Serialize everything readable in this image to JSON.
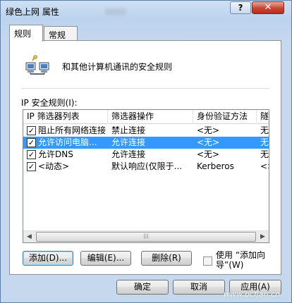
{
  "window": {
    "title": "绿色上网 属性",
    "help_label": "?",
    "close_label": "✕"
  },
  "tabs": [
    {
      "label": "规则",
      "active": true
    },
    {
      "label": "常规",
      "active": false
    }
  ],
  "header": {
    "icon": "network-computers-icon",
    "text": "和其他计算机通讯的安全规则"
  },
  "rules_list": {
    "label": "IP 安全规则(I):",
    "columns": [
      "IP 筛选器列表",
      "筛选器操作",
      "身份验证方法",
      "隧"
    ],
    "rows": [
      {
        "checked": true,
        "selected": false,
        "filter_list": "阻止所有网络连接",
        "action": "禁止连接",
        "auth": "<无>",
        "tunnel": "无"
      },
      {
        "checked": true,
        "selected": true,
        "filter_list": "允许访问电脑...",
        "action": "允许连接",
        "auth": "<无>",
        "tunnel": "无"
      },
      {
        "checked": true,
        "selected": false,
        "filter_list": "允许DNS",
        "action": "允许连接",
        "auth": "<无>",
        "tunnel": "无"
      },
      {
        "checked": true,
        "selected": false,
        "filter_list": "<动态>",
        "action": "默认响应(仅限于...",
        "auth": "Kerberos",
        "tunnel": "<>"
      }
    ]
  },
  "rule_buttons": {
    "add": "添加(D)...",
    "edit": "编辑(E)...",
    "delete": "删除(R)"
  },
  "wizard_checkbox": {
    "label": "使用 “添加向导”(W)",
    "checked": false
  },
  "dialog_buttons": {
    "ok": "确定",
    "cancel": "取消",
    "apply": "应用(A)"
  },
  "watermark": "www.pcfjan.cn"
}
